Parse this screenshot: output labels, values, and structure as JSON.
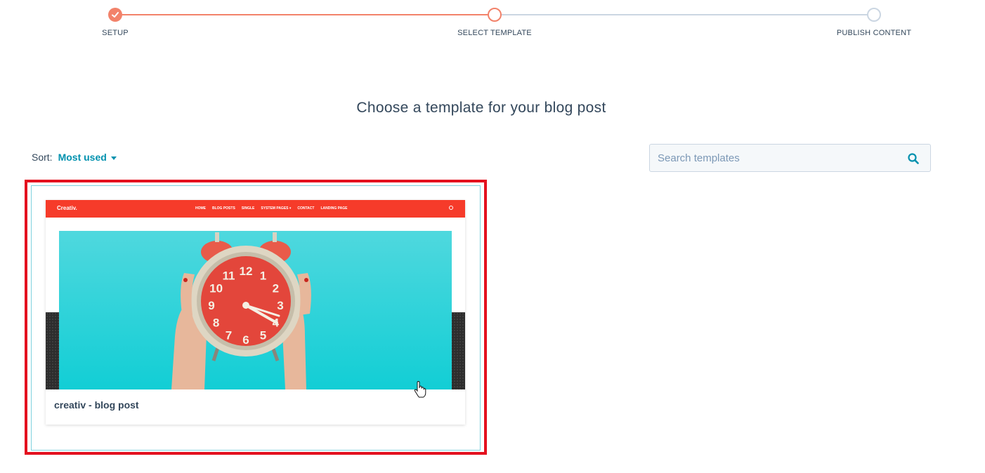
{
  "stepper": {
    "steps": [
      {
        "label": "SETUP",
        "state": "complete"
      },
      {
        "label": "SELECT TEMPLATE",
        "state": "active"
      },
      {
        "label": "PUBLISH CONTENT",
        "state": "pending"
      }
    ]
  },
  "heading": "Choose a template for your blog post",
  "sort": {
    "label": "Sort:",
    "value": "Most used"
  },
  "search": {
    "placeholder": "Search templates",
    "value": ""
  },
  "template_card": {
    "title": "creativ - blog post",
    "preview": {
      "logo": "Creativ.",
      "menu": [
        "HOME",
        "BLOG POSTS",
        "SINGLE",
        "SYSTEM PAGES ▾",
        "CONTACT",
        "LANDING PAGE"
      ],
      "clock_numbers": [
        "12",
        "1",
        "2",
        "3",
        "4",
        "5",
        "6",
        "7",
        "8",
        "9",
        "10",
        "11"
      ]
    }
  },
  "colors": {
    "accent_orange": "#f2826a",
    "link_teal": "#0091ae",
    "highlight_red": "#e4111f",
    "preview_nav_red": "#f63b2a",
    "preview_bg_cyan": "#12ced5"
  },
  "icons": {
    "step_complete": "check-icon",
    "search": "search-icon",
    "cursor": "hand-pointer-icon"
  }
}
